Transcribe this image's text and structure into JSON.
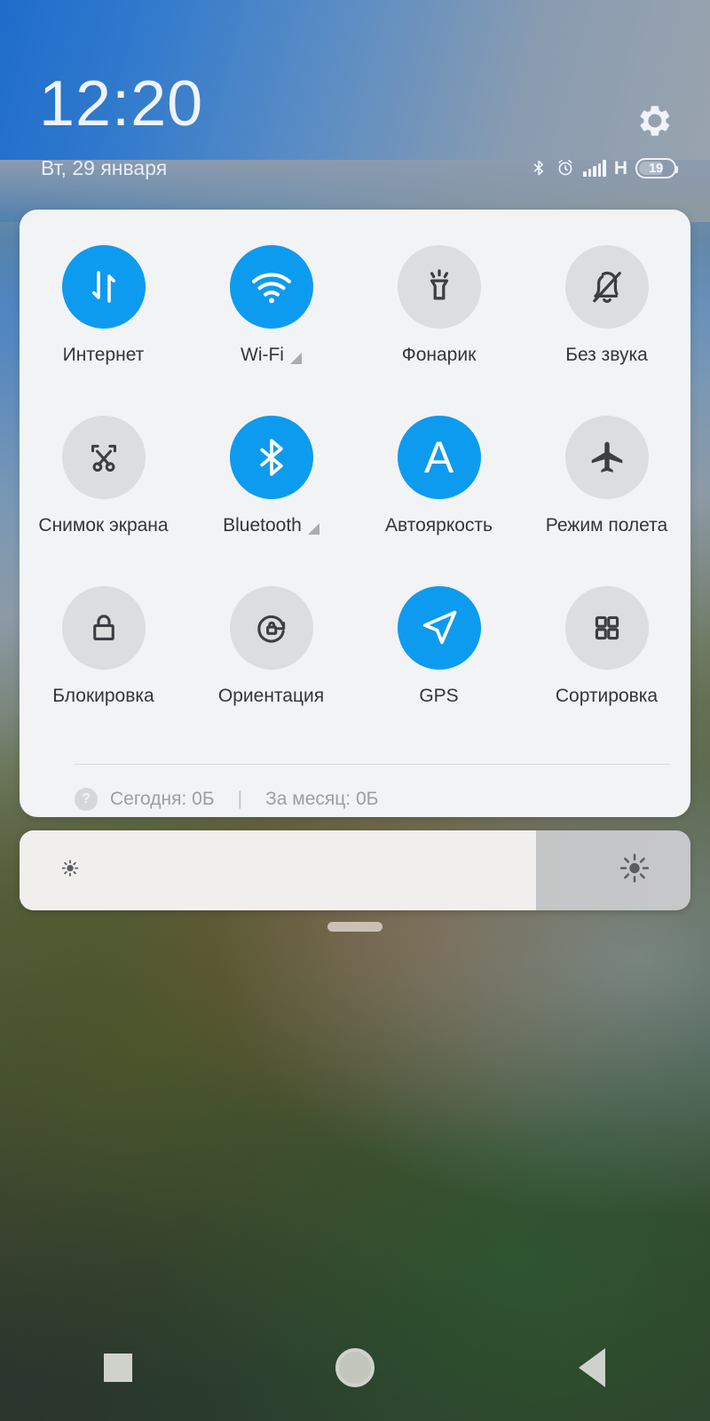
{
  "status_bar": {
    "clock": "12:20",
    "date": "Вт, 29 января",
    "gear_icon": "gear-icon",
    "icons": [
      "bluetooth-icon",
      "alarm-icon",
      "signal-bars-icon"
    ],
    "network_type": "H",
    "battery_level": "19"
  },
  "quick_settings": {
    "tiles": [
      {
        "label": "Интернет",
        "icon": "data-transfer-icon",
        "active": true,
        "expandable": false
      },
      {
        "label": "Wi-Fi",
        "icon": "wifi-icon",
        "active": true,
        "expandable": true
      },
      {
        "label": "Фонарик",
        "icon": "flashlight-icon",
        "active": false,
        "expandable": false
      },
      {
        "label": "Без звука",
        "icon": "bell-slash-icon",
        "active": false,
        "expandable": false
      },
      {
        "label": "Снимок экрана",
        "icon": "screenshot-icon",
        "active": false,
        "expandable": false
      },
      {
        "label": "Bluetooth",
        "icon": "bluetooth-icon",
        "active": true,
        "expandable": true
      },
      {
        "label": "Автояркость",
        "icon": "auto-brightness-icon",
        "active": true,
        "expandable": false
      },
      {
        "label": "Режим полета",
        "icon": "airplane-icon",
        "active": false,
        "expandable": false
      },
      {
        "label": "Блокировка",
        "icon": "lock-icon",
        "active": false,
        "expandable": false
      },
      {
        "label": "Ориентация",
        "icon": "rotation-lock-icon",
        "active": false,
        "expandable": false
      },
      {
        "label": "GPS",
        "icon": "navigation-arrow-icon",
        "active": true,
        "expandable": false
      },
      {
        "label": "Сортировка",
        "icon": "grid-icon",
        "active": false,
        "expandable": false
      }
    ],
    "data_usage": {
      "help_icon": "question-mark-icon",
      "today": "Сегодня: 0Б",
      "separator": "|",
      "month": "За месяц: 0Б"
    }
  },
  "brightness": {
    "value_percent": "77",
    "low_icon": "sun-small-icon",
    "high_icon": "sun-large-icon"
  },
  "nav_bar": {
    "recents": "square-icon",
    "home": "circle-icon",
    "back": "triangle-left-icon"
  },
  "colors": {
    "accent_active": "#0d9bf0",
    "tile_inactive": "#dcdddf",
    "panel_bg": "#f2f3f5",
    "icon_dark": "#3b3f43"
  }
}
